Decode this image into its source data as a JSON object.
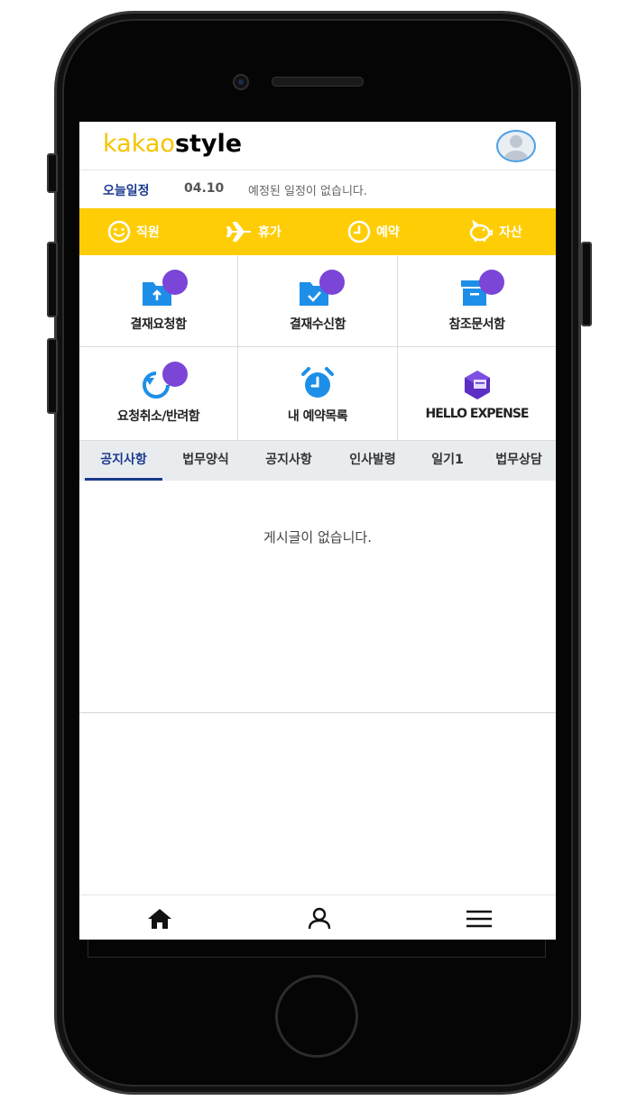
{
  "header": {
    "logo_kakao": "kakao",
    "logo_style": "style"
  },
  "schedule": {
    "label": "오늘일정",
    "date": "04.10",
    "message": "예정된 일정이 없습니다."
  },
  "quickbar": {
    "items": [
      {
        "label": "직원",
        "icon": "smile-icon"
      },
      {
        "label": "휴가",
        "icon": "airplane-icon"
      },
      {
        "label": "예약",
        "icon": "clock-icon"
      },
      {
        "label": "자산",
        "icon": "piggy-bank-icon"
      }
    ]
  },
  "grid": {
    "items": [
      {
        "label": "결재요청함",
        "icon": "folder-upload-icon"
      },
      {
        "label": "결재수신함",
        "icon": "folder-check-icon"
      },
      {
        "label": "참조문서함",
        "icon": "archive-box-icon"
      },
      {
        "label": "요청취소/반려함",
        "icon": "undo-circle-icon"
      },
      {
        "label": "내 예약목록",
        "icon": "alarm-clock-icon"
      },
      {
        "label": "HELLO EXPENSE",
        "icon": "hello-expense-logo-icon"
      }
    ]
  },
  "tabs": [
    {
      "label": "공지사항",
      "active": true
    },
    {
      "label": "법무양식",
      "active": false
    },
    {
      "label": "공지사항",
      "active": false
    },
    {
      "label": "인사발령",
      "active": false
    },
    {
      "label": "일기1",
      "active": false
    },
    {
      "label": "법무상담",
      "active": false
    }
  ],
  "content": {
    "empty_message": "게시글이 없습니다."
  },
  "bottomnav": {
    "items": [
      "home-icon",
      "user-icon",
      "menu-icon"
    ]
  },
  "colors": {
    "accent_yellow": "#ffcd05",
    "navy": "#1a3a8f",
    "badge_purple": "#7b45d8",
    "icon_blue": "#1d8fe8"
  }
}
